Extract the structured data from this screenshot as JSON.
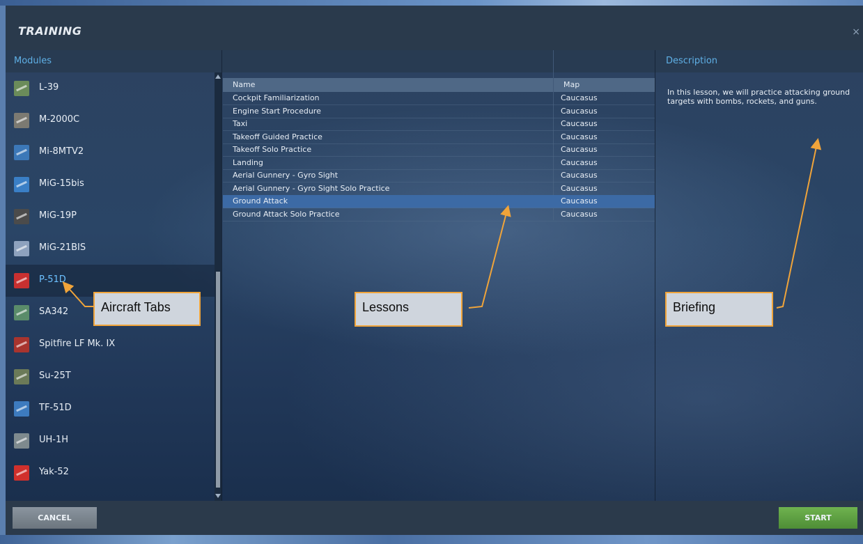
{
  "window": {
    "title": "TRAINING",
    "close_label": "×"
  },
  "headers": {
    "modules": "Modules",
    "description": "Description"
  },
  "modules": [
    {
      "label": "L-39",
      "icon": "l39-icon",
      "color": "#6b8c5a"
    },
    {
      "label": "M-2000C",
      "icon": "m2000c-icon",
      "color": "#7c7a72"
    },
    {
      "label": "Mi-8MTV2",
      "icon": "mi8-icon",
      "color": "#3c78b8"
    },
    {
      "label": "MiG-15bis",
      "icon": "mig15-icon",
      "color": "#3a7fc6"
    },
    {
      "label": "MiG-19P",
      "icon": "mig19-icon",
      "color": "#4b4b4b"
    },
    {
      "label": "MiG-21BIS",
      "icon": "mig21-icon",
      "color": "#8ea2be"
    },
    {
      "label": "P-51D",
      "icon": "p51d-icon",
      "color": "#c83030",
      "selected": true
    },
    {
      "label": "SA342",
      "icon": "sa342-icon",
      "color": "#5a8c6a"
    },
    {
      "label": "Spitfire LF Mk. IX",
      "icon": "spitfire-icon",
      "color": "#a8342e"
    },
    {
      "label": "Su-25T",
      "icon": "su25t-icon",
      "color": "#6b7a58"
    },
    {
      "label": "TF-51D",
      "icon": "tf51d-icon",
      "color": "#3d7bbf"
    },
    {
      "label": "UH-1H",
      "icon": "uh1h-icon",
      "color": "#7e8a8e"
    },
    {
      "label": "Yak-52",
      "icon": "yak52-icon",
      "color": "#d0302c"
    }
  ],
  "lessons": {
    "columns": {
      "name": "Name",
      "map": "Map"
    },
    "rows": [
      {
        "name": "Cockpit Familiarization",
        "map": "Caucasus"
      },
      {
        "name": "Engine Start Procedure",
        "map": "Caucasus"
      },
      {
        "name": "Taxi",
        "map": "Caucasus"
      },
      {
        "name": "Takeoff Guided Practice",
        "map": "Caucasus"
      },
      {
        "name": "Takeoff Solo Practice",
        "map": "Caucasus"
      },
      {
        "name": "Landing",
        "map": "Caucasus"
      },
      {
        "name": "Aerial Gunnery - Gyro Sight",
        "map": "Caucasus"
      },
      {
        "name": "Aerial Gunnery - Gyro Sight Solo Practice",
        "map": "Caucasus"
      },
      {
        "name": "Ground Attack",
        "map": "Caucasus",
        "selected": true
      },
      {
        "name": "Ground Attack Solo Practice",
        "map": "Caucasus"
      }
    ]
  },
  "description": {
    "text": "In this lesson, we will practice attacking ground targets with bombs, rockets, and guns."
  },
  "buttons": {
    "cancel": "CANCEL",
    "start": "START"
  },
  "annotations": {
    "aircraft_tabs": "Aircraft Tabs",
    "lessons": "Lessons",
    "briefing": "Briefing"
  },
  "colors": {
    "accent": "#6cc1ff",
    "selection": "#3c6aa5",
    "callout_border": "#f0a43a",
    "start": "#5a9e3f"
  }
}
